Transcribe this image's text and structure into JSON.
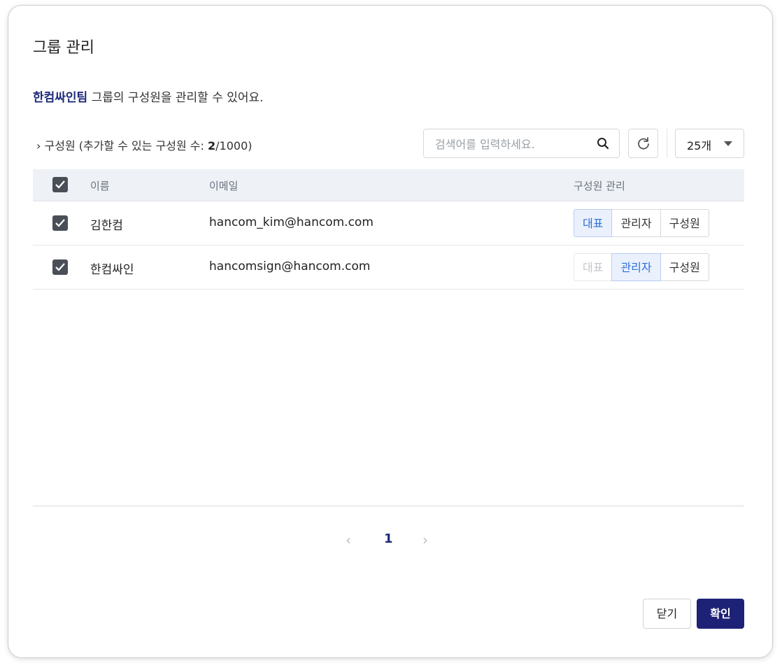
{
  "dialog": {
    "title": "그룹 관리",
    "subtitle_group": "한컴싸인팀",
    "subtitle_rest": " 그룹의 구성원을 관리할 수 있어요."
  },
  "members": {
    "toggle_glyph": "›",
    "label_prefix": "구성원 (추가할 수 있는 구성원 수: ",
    "count": "2",
    "label_suffix": "/1000)"
  },
  "search": {
    "placeholder": "검색어를 입력하세요.",
    "value": ""
  },
  "page_size": {
    "selected": "25개"
  },
  "table": {
    "headers": {
      "name": "이름",
      "email": "이메일",
      "role": "구성원 관리"
    },
    "rows": [
      {
        "name": "김한컴",
        "email": "hancom_kim@hancom.com",
        "checked": true,
        "roles": [
          "대표",
          "관리자",
          "구성원"
        ],
        "selected_role": "대표",
        "disabled_role": ""
      },
      {
        "name": "한컴싸인",
        "email": "hancomsign@hancom.com",
        "checked": true,
        "roles": [
          "대표",
          "관리자",
          "구성원"
        ],
        "selected_role": "관리자",
        "disabled_role": "대표"
      }
    ]
  },
  "pagination": {
    "prev": "‹",
    "current": "1",
    "next": "›"
  },
  "footer": {
    "close": "닫기",
    "confirm": "확인"
  },
  "colors": {
    "brand": "#1e2277",
    "accent": "#2f6fd8",
    "checkbox": "#4a4f57"
  }
}
